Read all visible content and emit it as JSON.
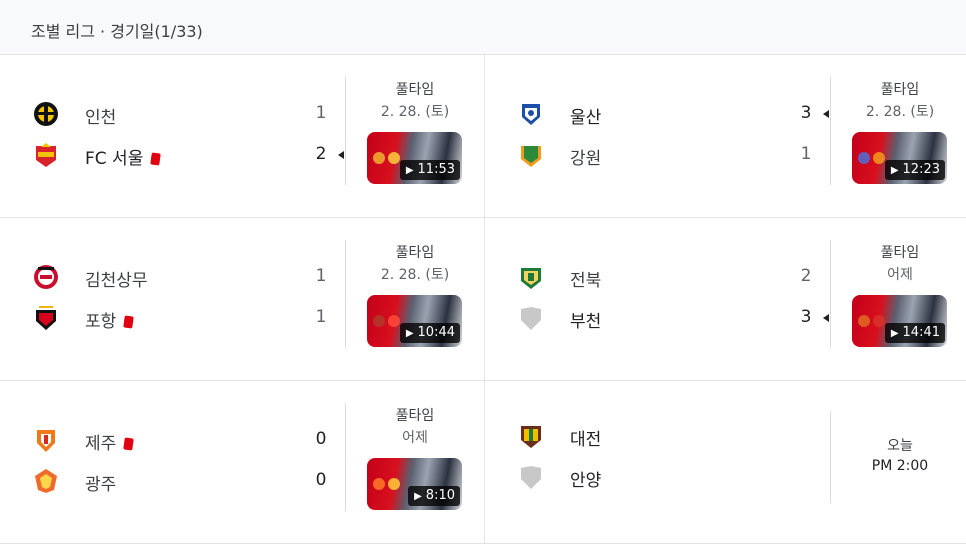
{
  "header": {
    "title": "조별 리그 · 경기일(1/33)"
  },
  "matches": [
    {
      "home": {
        "name": "인천",
        "score": "1"
      },
      "away": {
        "name": "FC 서울",
        "score": "2"
      },
      "status": "풀타임",
      "date": "2. 28. (토)",
      "duration": "11:53"
    },
    {
      "home": {
        "name": "울산",
        "score": "3"
      },
      "away": {
        "name": "강원",
        "score": "1"
      },
      "status": "풀타임",
      "date": "2. 28. (토)",
      "duration": "12:23"
    },
    {
      "home": {
        "name": "김천상무",
        "score": "1"
      },
      "away": {
        "name": "포항",
        "score": "1"
      },
      "status": "풀타임",
      "date": "2. 28. (토)",
      "duration": "10:44"
    },
    {
      "home": {
        "name": "전북",
        "score": "2"
      },
      "away": {
        "name": "부천",
        "score": "3"
      },
      "status": "풀타임",
      "date": "어제",
      "duration": "14:41"
    },
    {
      "home": {
        "name": "제주",
        "score": "0"
      },
      "away": {
        "name": "광주",
        "score": "0"
      },
      "status": "풀타임",
      "date": "어제",
      "duration": "8:10"
    },
    {
      "home": {
        "name": "대전"
      },
      "away": {
        "name": "안양"
      },
      "day": "오늘",
      "time": "PM 2:00"
    }
  ],
  "icons": {
    "play": "play-icon",
    "red_card": "red-card-icon",
    "win_arrow": "winner-arrow-icon"
  },
  "colors": {
    "red_card": "#e1000f",
    "header_bg": "#f8f9fa"
  }
}
